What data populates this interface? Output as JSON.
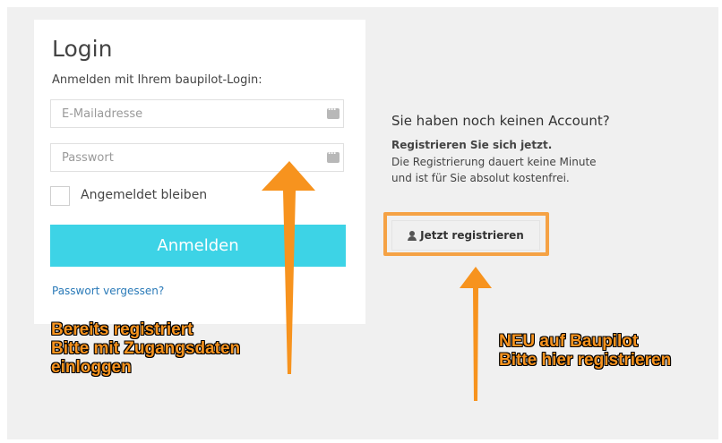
{
  "login": {
    "title": "Login",
    "subtitle": "Anmelden mit Ihrem baupilot-Login:",
    "email_placeholder": "E-Mailadresse",
    "password_placeholder": "Passwort",
    "remember_label": "Angemeldet bleiben",
    "submit_label": "Anmelden",
    "forgot_link": "Passwort vergessen?"
  },
  "register": {
    "heading": "Sie haben noch keinen Account?",
    "strong_text": "Registrieren Sie sich jetzt.",
    "text_line1": "Die Registrierung dauert keine Minute",
    "text_line2": "und ist für Sie absolut kostenfrei.",
    "button_label": "Jetzt registrieren",
    "button_icon": "user-icon"
  },
  "annotations": {
    "left_lines": [
      "Bereits registriert",
      "Bitte mit Zugangsdaten",
      "einloggen"
    ],
    "right_lines": [
      "NEU auf Baupilot",
      "Bitte hier registrieren"
    ]
  },
  "colors": {
    "page_background": "#f0f0f0",
    "login_button": "#3dd3e6",
    "link": "#2a7ab8",
    "annotation_orange": "#f7931e",
    "highlight_border": "#f5a245"
  }
}
